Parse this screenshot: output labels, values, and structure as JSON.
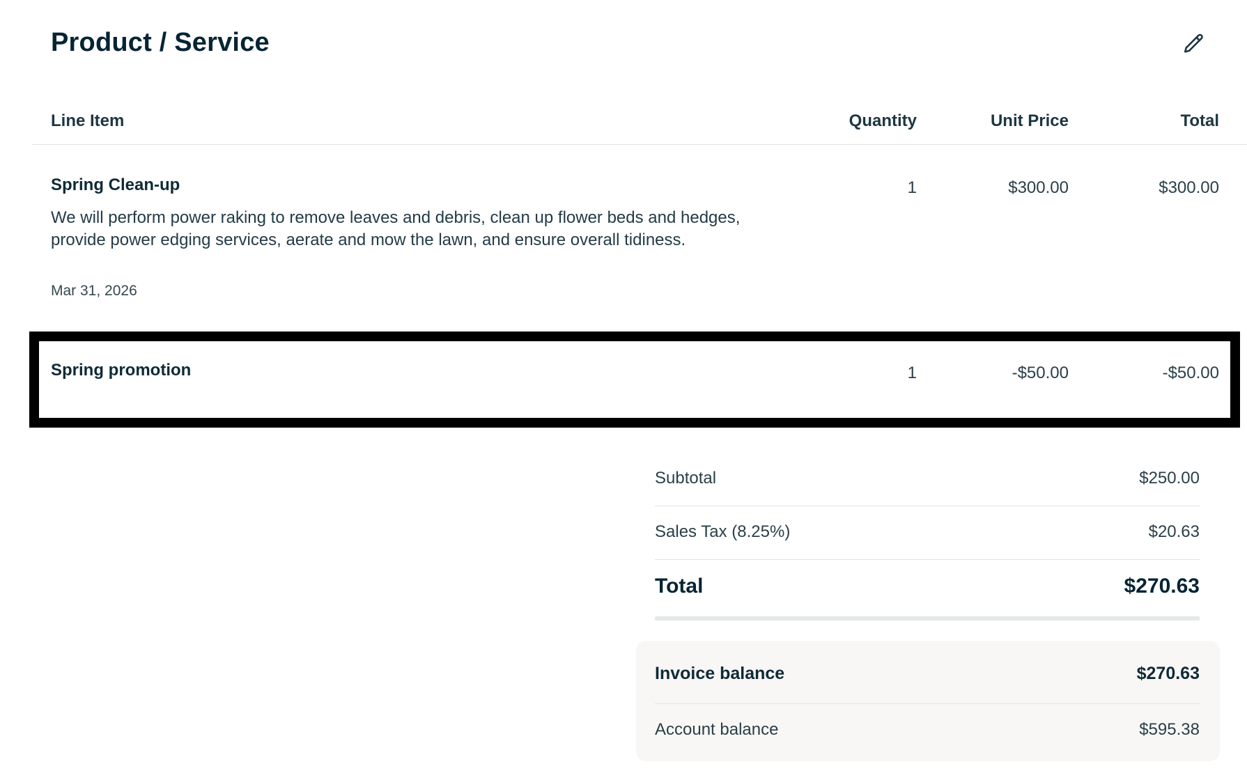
{
  "section": {
    "title": "Product / Service",
    "edit_icon": "pencil-icon"
  },
  "table": {
    "headers": {
      "line_item": "Line Item",
      "quantity": "Quantity",
      "unit_price": "Unit Price",
      "total": "Total"
    },
    "rows": [
      {
        "name": "Spring Clean-up",
        "description": "We will perform power raking to remove leaves and debris, clean up flower beds and hedges, provide power edging services, aerate and mow the lawn, and ensure overall tidiness.",
        "date": "Mar 31, 2026",
        "quantity": "1",
        "unit_price": "$300.00",
        "total": "$300.00"
      },
      {
        "name": "Spring promotion",
        "quantity": "1",
        "unit_price": "-$50.00",
        "total": "-$50.00"
      }
    ]
  },
  "summary": {
    "subtotal_label": "Subtotal",
    "subtotal_value": "$250.00",
    "tax_label": "Sales Tax (8.25%)",
    "tax_value": "$20.63",
    "total_label": "Total",
    "total_value": "$270.63"
  },
  "balances": {
    "invoice_label": "Invoice balance",
    "invoice_value": "$270.63",
    "account_label": "Account balance",
    "account_value": "$595.38"
  },
  "colors": {
    "heading": "#062433",
    "text": "#2a3f48",
    "highlight_border": "#000000",
    "balance_bg": "#f8f7f5"
  }
}
